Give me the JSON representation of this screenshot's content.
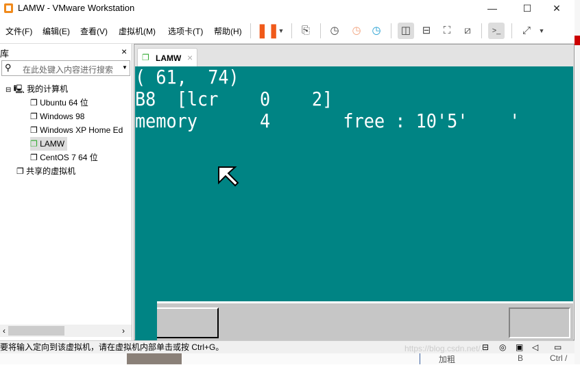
{
  "window": {
    "title": "LAMW - VMware Workstation",
    "minimize": "—",
    "maximize": "☐",
    "close": "✕"
  },
  "menu": [
    {
      "label": "文件(F)"
    },
    {
      "label": "编辑(E)"
    },
    {
      "label": "查看(V)"
    },
    {
      "label": "虚拟机(M)"
    },
    {
      "label": "选项卡(T)"
    },
    {
      "label": "帮助(H)"
    }
  ],
  "library": {
    "title": "库",
    "close": "×",
    "search_placeholder": "在此处键入内容进行搜索",
    "root": "我的计算机",
    "vms": [
      "Ubuntu 64 位",
      "Windows 98",
      "Windows XP Home Ed",
      "LAMW",
      "CentOS 7 64 位"
    ],
    "shared": "共享的虚拟机"
  },
  "tab": {
    "label": "LAMW",
    "close": "×"
  },
  "guest": {
    "line1": "( 61,  74)",
    "line2": "B8  [lcr    0    2]",
    "line3": "memory      4       free : 10'5'    '"
  },
  "status": {
    "text": "要将输入定向到该虚拟机，请在虚拟机内部单击或按 Ctrl+G。"
  },
  "background": {
    "watermark": "https://blog.csdn.net/...",
    "t1": "加粗",
    "t2": "B",
    "t3": "Ctrl /"
  }
}
